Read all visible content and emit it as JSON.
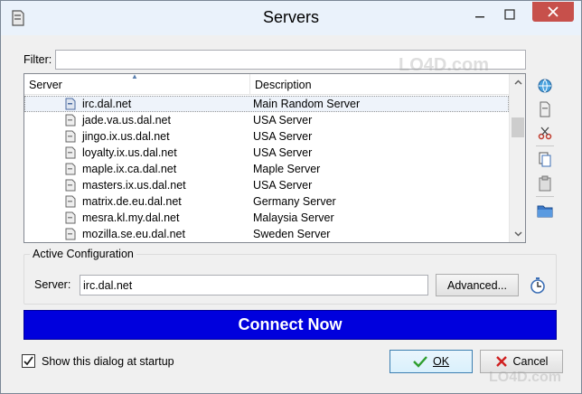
{
  "window": {
    "title": "Servers",
    "icons": {
      "app": "server-icon",
      "minimize": "minimize-icon",
      "maximize": "maximize-icon",
      "close": "close-icon"
    }
  },
  "filter": {
    "label": "Filter:",
    "value": "",
    "placeholder": ""
  },
  "list": {
    "columns": [
      "Server",
      "Description"
    ],
    "sort_column": "Server",
    "rows": [
      {
        "name": "irc.dal.net",
        "description": "Main Random Server",
        "selected": true
      },
      {
        "name": "jade.va.us.dal.net",
        "description": "USA Server"
      },
      {
        "name": "jingo.ix.us.dal.net",
        "description": "USA Server"
      },
      {
        "name": "loyalty.ix.us.dal.net",
        "description": "USA Server"
      },
      {
        "name": "maple.ix.ca.dal.net",
        "description": "Maple Server"
      },
      {
        "name": "masters.ix.us.dal.net",
        "description": "USA Server"
      },
      {
        "name": "matrix.de.eu.dal.net",
        "description": "Germany Server"
      },
      {
        "name": "mesra.kl.my.dal.net",
        "description": "Malaysia Server"
      },
      {
        "name": "mozilla.se.eu.dal.net",
        "description": "Sweden Server"
      }
    ]
  },
  "side_toolbar": {
    "icons": [
      "connect-globe-icon",
      "add-server-icon",
      "cut-icon",
      "copy-icon",
      "paste-icon",
      "open-folder-icon"
    ]
  },
  "active_configuration": {
    "title": "Active Configuration",
    "server_label": "Server:",
    "server_value": "irc.dal.net",
    "advanced_label": "Advanced...",
    "timer_icon": "clock-icon"
  },
  "connect_button": {
    "label": "Connect Now",
    "color": "#0000dd"
  },
  "footer": {
    "show_at_startup_label": "Show this dialog at startup",
    "show_at_startup_checked": true,
    "ok_label": "OK",
    "cancel_label": "Cancel"
  },
  "watermark": "LO4D.com"
}
